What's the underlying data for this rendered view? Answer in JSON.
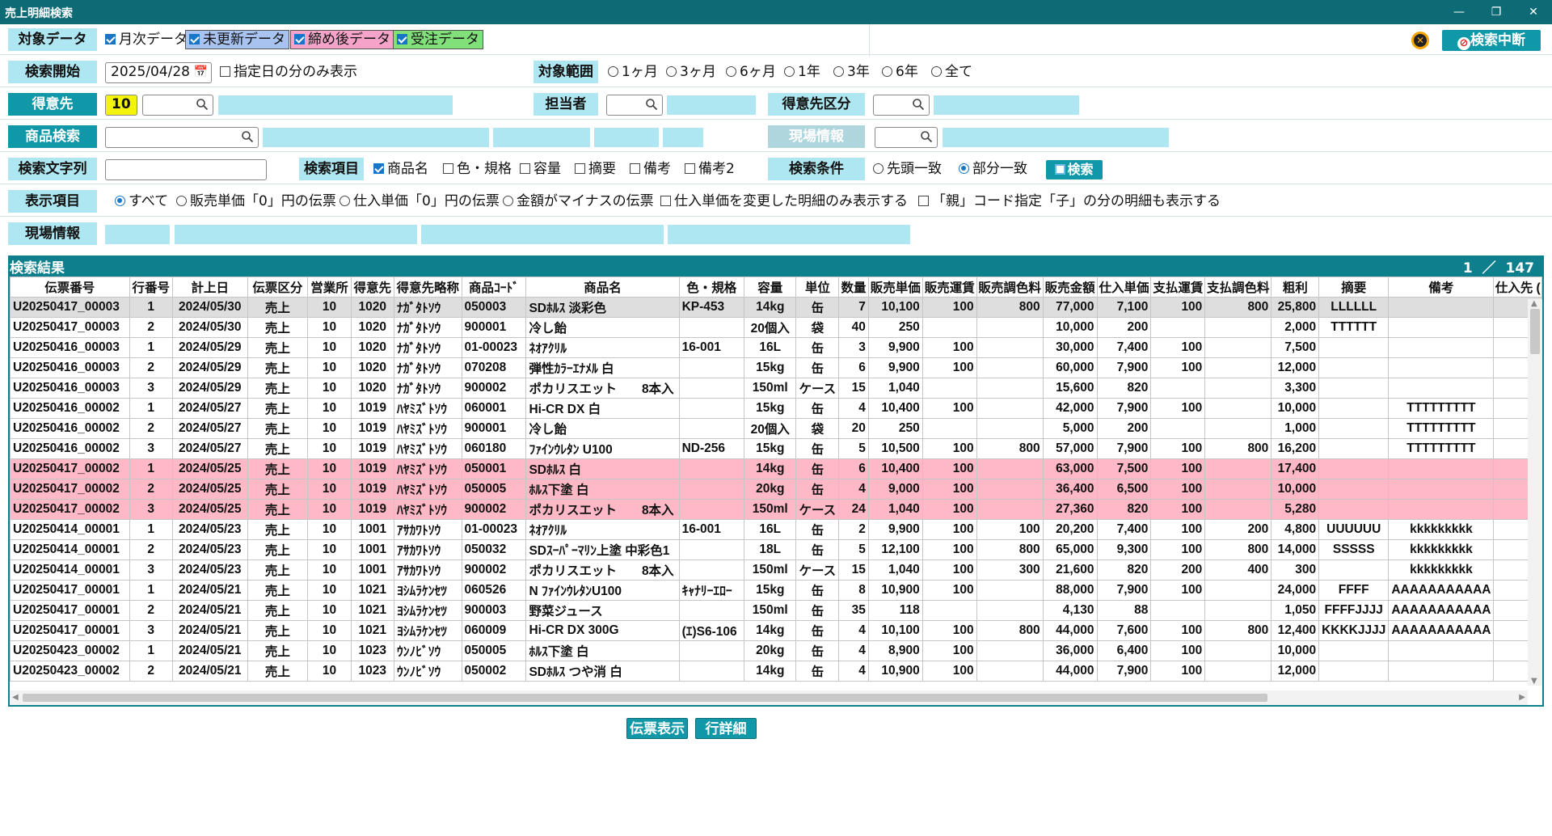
{
  "window": {
    "title": "売上明細検索",
    "minimize": "—",
    "maximize": "❐",
    "close": "✕"
  },
  "labels": {
    "target_data": "対象データ",
    "search_start": "検索開始",
    "target_range": "対象範囲",
    "customer": "得意先",
    "staff": "担当者",
    "customer_class": "得意先区分",
    "product_search": "商品検索",
    "site_info_disabled": "現場情報",
    "search_text": "検索文字列",
    "search_fields": "検索項目",
    "search_condition": "検索条件",
    "display_items": "表示項目",
    "site_info": "現場情報"
  },
  "target_data": {
    "monthly": "月次データ",
    "unupdated": "未更新データ",
    "closed": "締め後データ",
    "order": "受注データ"
  },
  "colors": {
    "unupdated": "#a9c3f0",
    "closed": "#f5a3c9",
    "order": "#82e07a",
    "accent": "#1098a8",
    "title": "#0e6b76"
  },
  "buttons": {
    "stop": "検索中断",
    "search": "検索",
    "show_slip": "伝票表示",
    "line_detail": "行詳細"
  },
  "search_start": {
    "date": "2025/04/28",
    "only_date": "指定日の分のみ表示"
  },
  "ranges": [
    "1ヶ月",
    "3ヶ月",
    "6ヶ月",
    "1年",
    "3年",
    "6年",
    "全て"
  ],
  "customer": {
    "code": "10"
  },
  "search_fields": [
    "商品名",
    "色・規格",
    "容量",
    "摘要",
    "備考",
    "備考2"
  ],
  "conditions": [
    "先頭一致",
    "部分一致"
  ],
  "display": {
    "all": "すべて",
    "sale_zero": "販売単価「0」円の伝票",
    "purchase_zero": "仕入単価「0」円の伝票",
    "minus": "金額がマイナスの伝票",
    "changed_only": "仕入単価を変更した明細のみ表示する",
    "parent_child": "「親」コード指定「子」の分の明細も表示する"
  },
  "results": {
    "title": "検索結果",
    "page": "1",
    "slash": "／",
    "total": "147"
  },
  "columns": [
    "伝票番号",
    "行番号",
    "計上日",
    "伝票区分",
    "営業所",
    "得意先",
    "得意先略称",
    "商品ｺｰﾄﾞ",
    "商品名",
    "色・規格",
    "容量",
    "単位",
    "数量",
    "販売単価",
    "販売運賃",
    "販売調色料",
    "販売金額",
    "仕入単価",
    "支払運賃",
    "支払調色料",
    "粗利",
    "摘要",
    "備考",
    "仕入先 ("
  ],
  "rows": [
    [
      "U20250417_00003",
      "1",
      "2024/05/30",
      "売上",
      "10",
      "1020",
      "ﾅｶﾞﾀﾄｿｳ",
      "050003",
      "SDﾎﾙｽ 淡彩色",
      "KP-453",
      "14kg",
      "缶",
      "7",
      "10,100",
      "100",
      "800",
      "77,000",
      "7,100",
      "100",
      "800",
      "25,800",
      "LLLLLL",
      "",
      ""
    ],
    [
      "U20250417_00003",
      "2",
      "2024/05/30",
      "売上",
      "10",
      "1020",
      "ﾅｶﾞﾀﾄｿｳ",
      "900001",
      "冷し飴",
      "",
      "20個入",
      "袋",
      "40",
      "250",
      "",
      "",
      "10,000",
      "200",
      "",
      "",
      "2,000",
      "TTTTTT",
      "",
      ""
    ],
    [
      "U20250416_00003",
      "1",
      "2024/05/29",
      "売上",
      "10",
      "1020",
      "ﾅｶﾞﾀﾄｿｳ",
      "01-00023",
      "ﾈｵｱｸﾘﾙ",
      "16-001",
      "16L",
      "缶",
      "3",
      "9,900",
      "100",
      "",
      "30,000",
      "7,400",
      "100",
      "",
      "7,500",
      "",
      "",
      ""
    ],
    [
      "U20250416_00003",
      "2",
      "2024/05/29",
      "売上",
      "10",
      "1020",
      "ﾅｶﾞﾀﾄｿｳ",
      "070208",
      "弾性ｶﾗｰｴﾅﾒﾙ 白",
      "",
      "15kg",
      "缶",
      "6",
      "9,900",
      "100",
      "",
      "60,000",
      "7,900",
      "100",
      "",
      "12,000",
      "",
      "",
      ""
    ],
    [
      "U20250416_00003",
      "3",
      "2024/05/29",
      "売上",
      "10",
      "1020",
      "ﾅｶﾞﾀﾄｿｳ",
      "900002",
      "ポカリスエット　　8本入",
      "",
      "150ml",
      "ケース",
      "15",
      "1,040",
      "",
      "",
      "15,600",
      "820",
      "",
      "",
      "3,300",
      "",
      "",
      ""
    ],
    [
      "U20250416_00002",
      "1",
      "2024/05/27",
      "売上",
      "10",
      "1019",
      "ﾊﾔﾐｽﾞﾄｿｳ",
      "060001",
      "Hi-CR DX 白",
      "",
      "15kg",
      "缶",
      "4",
      "10,400",
      "100",
      "",
      "42,000",
      "7,900",
      "100",
      "",
      "10,000",
      "",
      "TTTTTTTTT",
      ""
    ],
    [
      "U20250416_00002",
      "2",
      "2024/05/27",
      "売上",
      "10",
      "1019",
      "ﾊﾔﾐｽﾞﾄｿｳ",
      "900001",
      "冷し飴",
      "",
      "20個入",
      "袋",
      "20",
      "250",
      "",
      "",
      "5,000",
      "200",
      "",
      "",
      "1,000",
      "",
      "TTTTTTTTT",
      ""
    ],
    [
      "U20250416_00002",
      "3",
      "2024/05/27",
      "売上",
      "10",
      "1019",
      "ﾊﾔﾐｽﾞﾄｿｳ",
      "060180",
      "ﾌｧｲﾝｳﾚﾀﾝ U100",
      "ND-256",
      "15kg",
      "缶",
      "5",
      "10,500",
      "100",
      "800",
      "57,000",
      "7,900",
      "100",
      "800",
      "16,200",
      "",
      "TTTTTTTTT",
      ""
    ],
    [
      "U20250417_00002",
      "1",
      "2024/05/25",
      "売上",
      "10",
      "1019",
      "ﾊﾔﾐｽﾞﾄｿｳ",
      "050001",
      "SDﾎﾙｽ 白",
      "",
      "14kg",
      "缶",
      "6",
      "10,400",
      "100",
      "",
      "63,000",
      "7,500",
      "100",
      "",
      "17,400",
      "",
      "",
      ""
    ],
    [
      "U20250417_00002",
      "2",
      "2024/05/25",
      "売上",
      "10",
      "1019",
      "ﾊﾔﾐｽﾞﾄｿｳ",
      "050005",
      "ﾎﾙｽ下塗 白",
      "",
      "20kg",
      "缶",
      "4",
      "9,000",
      "100",
      "",
      "36,400",
      "6,500",
      "100",
      "",
      "10,000",
      "",
      "",
      ""
    ],
    [
      "U20250417_00002",
      "3",
      "2024/05/25",
      "売上",
      "10",
      "1019",
      "ﾊﾔﾐｽﾞﾄｿｳ",
      "900002",
      "ポカリスエット　　8本入",
      "",
      "150ml",
      "ケース",
      "24",
      "1,040",
      "100",
      "",
      "27,360",
      "820",
      "100",
      "",
      "5,280",
      "",
      "",
      ""
    ],
    [
      "U20250414_00001",
      "1",
      "2024/05/23",
      "売上",
      "10",
      "1001",
      "ｱｻｶﾜﾄｿｳ",
      "01-00023",
      "ﾈｵｱｸﾘﾙ",
      "16-001",
      "16L",
      "缶",
      "2",
      "9,900",
      "100",
      "100",
      "20,200",
      "7,400",
      "100",
      "200",
      "4,800",
      "UUUUUU",
      "kkkkkkkkk",
      ""
    ],
    [
      "U20250414_00001",
      "2",
      "2024/05/23",
      "売上",
      "10",
      "1001",
      "ｱｻｶﾜﾄｿｳ",
      "050032",
      "SDｽｰﾊﾟｰﾏﾘﾝ上塗 中彩色1",
      "",
      "18L",
      "缶",
      "5",
      "12,100",
      "100",
      "800",
      "65,000",
      "9,300",
      "100",
      "800",
      "14,000",
      "SSSSS",
      "kkkkkkkkk",
      ""
    ],
    [
      "U20250414_00001",
      "3",
      "2024/05/23",
      "売上",
      "10",
      "1001",
      "ｱｻｶﾜﾄｿｳ",
      "900002",
      "ポカリスエット　　8本入",
      "",
      "150ml",
      "ケース",
      "15",
      "1,040",
      "100",
      "300",
      "21,600",
      "820",
      "200",
      "400",
      "300",
      "",
      "kkkkkkkkk",
      ""
    ],
    [
      "U20250417_00001",
      "1",
      "2024/05/21",
      "売上",
      "10",
      "1021",
      "ﾖｼﾑﾗｹﾝｾﾂ",
      "060526",
      "N ﾌｧｲﾝｳﾚﾀﾝU100",
      "ｷｬﾅﾘｰｴﾛｰ",
      "15kg",
      "缶",
      "8",
      "10,900",
      "100",
      "",
      "88,000",
      "7,900",
      "100",
      "",
      "24,000",
      "FFFF",
      "AAAAAAAAAAA",
      ""
    ],
    [
      "U20250417_00001",
      "2",
      "2024/05/21",
      "売上",
      "10",
      "1021",
      "ﾖｼﾑﾗｹﾝｾﾂ",
      "900003",
      "野菜ジュース",
      "",
      "150ml",
      "缶",
      "35",
      "118",
      "",
      "",
      "4,130",
      "88",
      "",
      "",
      "1,050",
      "FFFFJJJJ",
      "AAAAAAAAAAA",
      ""
    ],
    [
      "U20250417_00001",
      "3",
      "2024/05/21",
      "売上",
      "10",
      "1021",
      "ﾖｼﾑﾗｹﾝｾﾂ",
      "060009",
      "Hi-CR DX 300G",
      "(ｴ)S6-106",
      "14kg",
      "缶",
      "4",
      "10,100",
      "100",
      "800",
      "44,000",
      "7,600",
      "100",
      "800",
      "12,400",
      "KKKKJJJJ",
      "AAAAAAAAAAA",
      ""
    ],
    [
      "U20250423_00002",
      "1",
      "2024/05/21",
      "売上",
      "10",
      "1023",
      "ｳﾝﾉﾋﾞｿｳ",
      "050005",
      "ﾎﾙｽ下塗 白",
      "",
      "20kg",
      "缶",
      "4",
      "8,900",
      "100",
      "",
      "36,000",
      "6,400",
      "100",
      "",
      "10,000",
      "",
      "",
      ""
    ],
    [
      "U20250423_00002",
      "2",
      "2024/05/21",
      "売上",
      "10",
      "1023",
      "ｳﾝﾉﾋﾞｿｳ",
      "050002",
      "SDﾎﾙｽ つや消 白",
      "",
      "14kg",
      "缶",
      "4",
      "10,900",
      "100",
      "",
      "44,000",
      "7,900",
      "100",
      "",
      "12,000",
      "",
      "",
      ""
    ]
  ]
}
